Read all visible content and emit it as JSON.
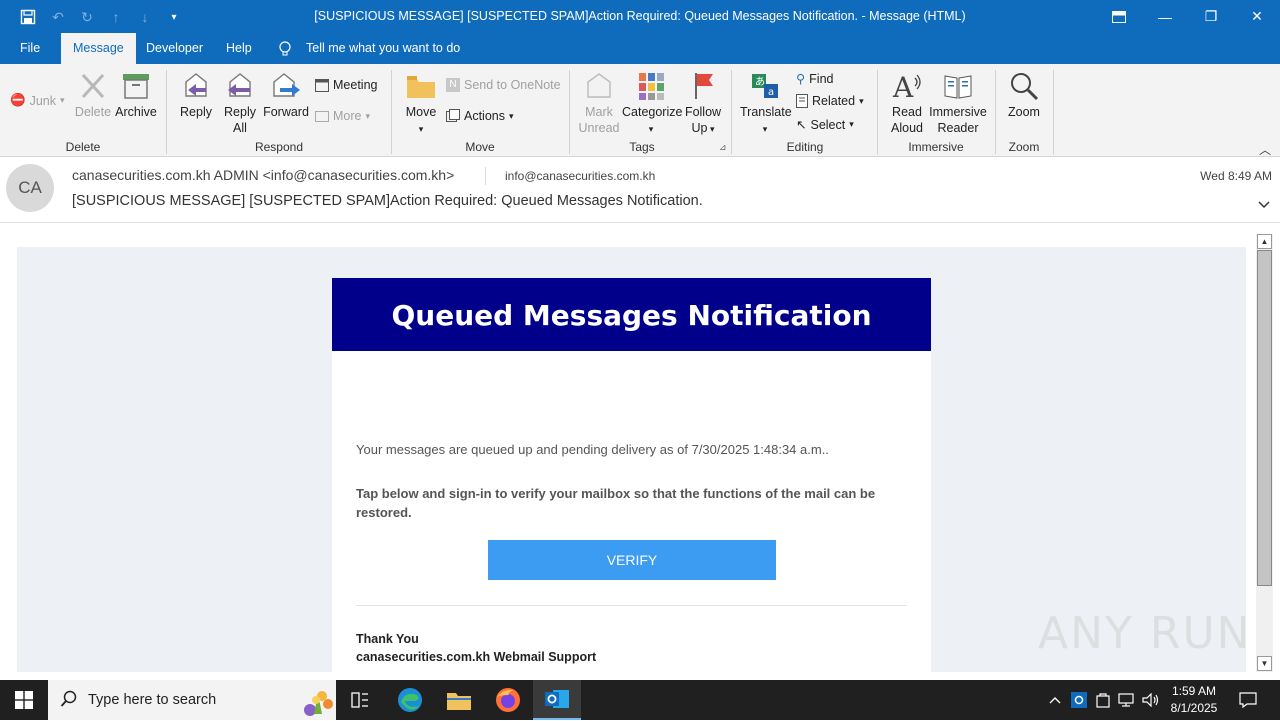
{
  "window": {
    "title": "[SUSPICIOUS MESSAGE] [SUSPECTED SPAM]Action Required: Queued Messages Notification.  -  Message (HTML)"
  },
  "tabs": [
    "File",
    "Message",
    "Developer",
    "Help"
  ],
  "tell_me": "Tell me what you want to do",
  "ribbon": {
    "delete": {
      "junk": "Junk",
      "delete": "Delete",
      "archive": "Archive",
      "group": "Delete"
    },
    "respond": {
      "reply": "Reply",
      "reply_all_1": "Reply",
      "reply_all_2": "All",
      "forward": "Forward",
      "meeting": "Meeting",
      "more": "More",
      "group": "Respond"
    },
    "move": {
      "move": "Move",
      "send_onenote": "Send to OneNote",
      "actions": "Actions",
      "group": "Move"
    },
    "tags": {
      "mark_1": "Mark",
      "mark_2": "Unread",
      "categorize": "Categorize",
      "follow_1": "Follow",
      "follow_2": "Up",
      "group": "Tags"
    },
    "editing": {
      "translate": "Translate",
      "find": "Find",
      "related": "Related",
      "select": "Select",
      "group": "Editing"
    },
    "immersive": {
      "read_1": "Read",
      "read_2": "Aloud",
      "immersive_1": "Immersive",
      "immersive_2": "Reader",
      "group": "Immersive"
    },
    "zoom": {
      "zoom": "Zoom",
      "group": "Zoom"
    }
  },
  "message": {
    "avatar_initials": "CA",
    "from": "canasecurities.com.kh ADMIN <info@canasecurities.com.kh>",
    "to": "info@canasecurities.com.kh",
    "time": "Wed 8:49 AM",
    "subject": "[SUSPICIOUS MESSAGE] [SUSPECTED SPAM]Action Required: Queued Messages Notification."
  },
  "email": {
    "banner": "Queued Messages Notification",
    "para1": "Your messages are queued up and pending delivery as of 7/30/2025 1:48:34 a.m..",
    "para2": "Tap below and sign-in to verify your mailbox so that the functions of the mail can be restored.",
    "button": "VERIFY",
    "sign1": "Thank You",
    "sign2": "canasecurities.com.kh Webmail Support"
  },
  "watermark": "ANY RUN",
  "taskbar": {
    "search_placeholder": "Type here to search",
    "time": "1:59 AM",
    "date": "8/1/2025"
  },
  "colors": {
    "office_blue": "#0f6cbd",
    "banner_navy": "#00008b",
    "verify_button": "#3c9cf2"
  }
}
